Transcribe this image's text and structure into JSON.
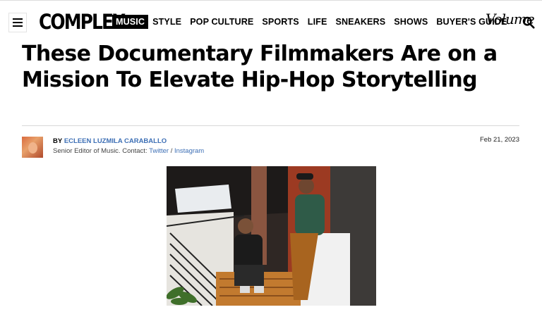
{
  "nav": {
    "logo": "COMPLEX",
    "items": [
      {
        "label": "MUSIC",
        "active": true
      },
      {
        "label": "STYLE",
        "active": false
      },
      {
        "label": "POP CULTURE",
        "active": false
      },
      {
        "label": "SPORTS",
        "active": false
      },
      {
        "label": "LIFE",
        "active": false
      },
      {
        "label": "SNEAKERS",
        "active": false
      },
      {
        "label": "SHOWS",
        "active": false
      },
      {
        "label": "BUYER'S GUIDE",
        "active": false
      }
    ],
    "volume_logo": "Volume",
    "icons": {
      "menu": "hamburger-menu-icon",
      "search": "search-icon"
    }
  },
  "article": {
    "title": "These Documentary Filmmakers Are on a Mission To Elevate Hip-Hop Storytelling",
    "by_prefix": "BY",
    "author": "ECLEEN LUZMILA CARABALLO",
    "role_text": "Senior Editor of Music. Contact:",
    "twitter": "Twitter",
    "separator": "/",
    "instagram": "Instagram",
    "date": "Feb 21, 2023"
  },
  "colors": {
    "link": "#3d6fb5",
    "text": "#000000",
    "active_nav_bg": "#000000"
  }
}
